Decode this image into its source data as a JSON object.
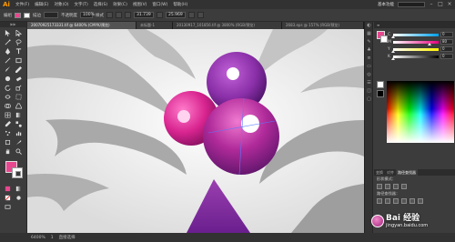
{
  "app": {
    "logo": "Ai"
  },
  "menu": [
    "文件(F)",
    "编辑(E)",
    "对象(O)",
    "文字(T)",
    "选择(S)",
    "效果(C)",
    "视图(V)",
    "窗口(W)",
    "帮助(H)"
  ],
  "workspace": {
    "label": "基本功能"
  },
  "control_bar": {
    "label": "编组",
    "stroke_label": "描边",
    "opacity_label": "不透明度",
    "opacity_value": "100%",
    "style_label": "样式",
    "w_value": "31.739",
    "h_value": "25.969"
  },
  "tabs": [
    {
      "label": "20070925173331.tif @ 6400% (CMYK/预览)",
      "active": true
    },
    {
      "label": "未标题-1",
      "active": false
    },
    {
      "label": "20130917_101856.tif @ 3800% (RGB/预览)",
      "active": false
    },
    {
      "label": "2683.eps @ 157% (RGB/预览)",
      "active": false
    }
  ],
  "toolbar": {
    "head": "▶▶"
  },
  "color_panel": {
    "sliders": [
      {
        "label": "C",
        "value": "0",
        "gradient": "linear-gradient(to right,#ffffff,#00a0e9)",
        "pos": 0.0
      },
      {
        "label": "M",
        "value": "80",
        "gradient": "linear-gradient(to right,#ffffff,#e4007f)",
        "pos": 0.8
      },
      {
        "label": "Y",
        "value": "0",
        "gradient": "linear-gradient(to right,#ffffff,#fff100)",
        "pos": 0.0
      },
      {
        "label": "K",
        "value": "0",
        "gradient": "linear-gradient(to right,#ffffff,#000000)",
        "pos": 0.0
      }
    ]
  },
  "layers_panel": {
    "tabs": [
      "变换",
      "对齐",
      "路径查找器"
    ],
    "rows": [
      "形状模式：",
      "路径查找器："
    ]
  },
  "status": {
    "zoom": "6400%",
    "page": "1",
    "tool": "直接选择"
  },
  "watermark": {
    "line1": "Bai 经验",
    "line2": "jingyan.baidu.com"
  },
  "colors": {
    "accent": "#e8478f",
    "purple": "#7a2a9c",
    "magenta": "#d12a8c"
  }
}
